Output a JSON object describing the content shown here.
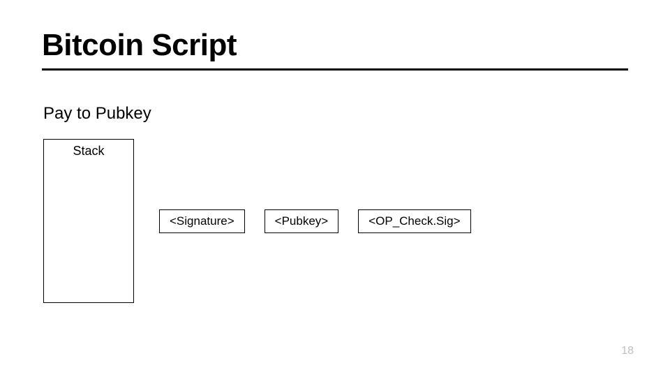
{
  "title": "Bitcoin Script",
  "subtitle": "Pay to Pubkey",
  "stack_label": "Stack",
  "ops": {
    "signature": "<Signature>",
    "pubkey": "<Pubkey>",
    "checksig": "<OP_Check.Sig>"
  },
  "page_number": "18"
}
